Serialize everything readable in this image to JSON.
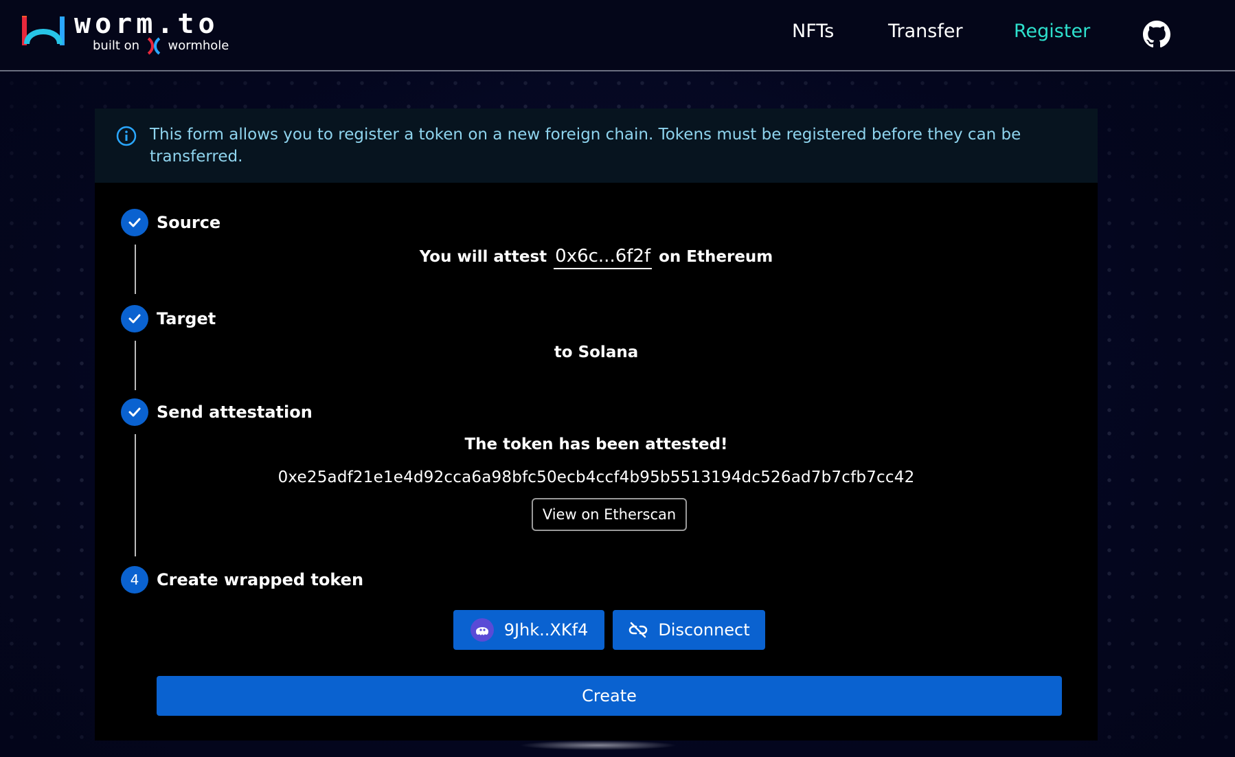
{
  "header": {
    "logo_text": "worm.to",
    "logo_subtitle_prefix": "built on",
    "logo_subtitle_brand": "wormhole",
    "nav": {
      "nfts": "NFTs",
      "transfer": "Transfer",
      "register": "Register"
    },
    "active_nav": "Register",
    "github_icon": "github-icon",
    "accent_color": "#2ee0cd"
  },
  "alert": {
    "icon": "info-icon",
    "text": "This form allows you to register a token on a new foreign chain. Tokens must be registered before they can be transferred."
  },
  "steps": [
    {
      "marker": "check",
      "label": "Source"
    },
    {
      "marker": "check",
      "label": "Target"
    },
    {
      "marker": "check",
      "label": "Send attestation"
    },
    {
      "marker": "4",
      "label": "Create wrapped token"
    }
  ],
  "source": {
    "prefix": "You will attest",
    "address": "0x6c...6f2f",
    "suffix": "on Ethereum"
  },
  "target": {
    "text": "to Solana"
  },
  "attestation": {
    "status": "The token has been attested!",
    "tx_hash": "0xe25adf21e1e4d92cca6a98bfc50ecb4ccf4b95b5513194dc526ad7b7cfb7cc42",
    "explorer_button": "View on Etherscan"
  },
  "wallet": {
    "address_button": "9Jhk..XKf4",
    "wallet_icon": "phantom-wallet-icon",
    "disconnect_button": "Disconnect",
    "disconnect_icon": "unlink-icon"
  },
  "create_button": "Create",
  "colors": {
    "primary": "#0a62d0",
    "alert_text": "#8fd4ee",
    "alert_bg": "#07141f"
  }
}
